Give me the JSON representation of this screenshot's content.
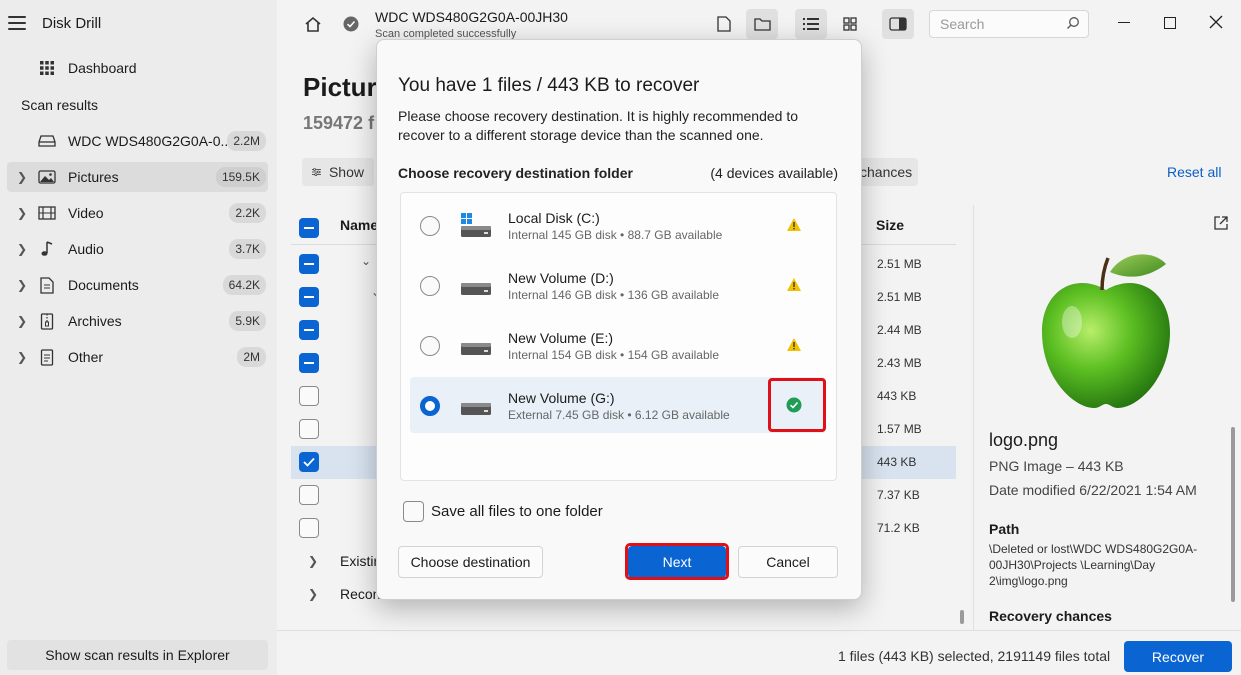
{
  "app": {
    "title": "Disk Drill"
  },
  "sidebar": {
    "dashboard_label": "Dashboard",
    "scan_results_label": "Scan results",
    "disk_item": {
      "label": "WDC WDS480G2G0A-0...",
      "count": "2.2M"
    },
    "items": [
      {
        "label": "Pictures",
        "count": "159.5K",
        "icon": "image-icon"
      },
      {
        "label": "Video",
        "count": "2.2K",
        "icon": "film-icon"
      },
      {
        "label": "Audio",
        "count": "3.7K",
        "icon": "music-note-icon"
      },
      {
        "label": "Documents",
        "count": "64.2K",
        "icon": "document-icon"
      },
      {
        "label": "Archives",
        "count": "5.9K",
        "icon": "archive-icon"
      },
      {
        "label": "Other",
        "count": "2M",
        "icon": "file-icon"
      }
    ],
    "show_explorer_label": "Show scan results in Explorer"
  },
  "header": {
    "disk_title": "WDC WDS480G2G0A-00JH30",
    "disk_status": "Scan completed successfully",
    "search_placeholder": "Search"
  },
  "main": {
    "page_title": "Pictur",
    "page_sub": "159472 f",
    "show_label": "Show",
    "chances_label": "chances",
    "reset_all": "Reset all",
    "col_name": "Name",
    "col_size": "Size",
    "rows": [
      {
        "size": "2.51 MB"
      },
      {
        "size": "2.51 MB"
      },
      {
        "size": "2.44 MB"
      },
      {
        "size": "2.43 MB"
      },
      {
        "size": "443 KB"
      },
      {
        "size": "1.57 MB"
      },
      {
        "size": "443 KB"
      },
      {
        "size": "7.37 KB"
      },
      {
        "size": "71.2 KB"
      }
    ],
    "group_existing": "Existin",
    "group_recon": "Recon"
  },
  "preview": {
    "file_name": "logo.png",
    "file_type": "PNG Image – 443 KB",
    "date_modified": "Date modified 6/22/2021 1:54 AM",
    "path_heading": "Path",
    "path_value": "\\Deleted or lost\\WDC WDS480G2G0A-00JH30\\Projects \\Learning\\Day 2\\img\\logo.png",
    "recovery_heading": "Recovery chances"
  },
  "bottombar": {
    "status": "1 files (443 KB) selected, 2191149 files total",
    "recover_label": "Recover"
  },
  "dialog": {
    "title": "You have 1 files / 443 KB to recover",
    "description": "Please choose recovery destination. It is highly recommended to recover to a different storage device than the scanned one.",
    "choose_label": "Choose recovery destination folder",
    "devices_available": "(4 devices available)",
    "devices": [
      {
        "name": "Local Disk (C:)",
        "info": "Internal 145 GB disk • 88.7 GB available",
        "state": "warning"
      },
      {
        "name": "New Volume (D:)",
        "info": "Internal 146 GB disk • 136 GB available",
        "state": "warning"
      },
      {
        "name": "New Volume (E:)",
        "info": "Internal 154 GB disk • 154 GB available",
        "state": "warning"
      },
      {
        "name": "New Volume (G:)",
        "info": "External 7.45 GB disk • 6.12 GB available",
        "state": "ok"
      }
    ],
    "save_all_label": "Save all files to one folder",
    "choose_destination_label": "Choose destination",
    "next_label": "Next",
    "cancel_label": "Cancel"
  },
  "colors": {
    "accent": "#0a64d2",
    "highlight": "#e01018",
    "warning": "#f2c200",
    "ok": "#1f9d55"
  }
}
